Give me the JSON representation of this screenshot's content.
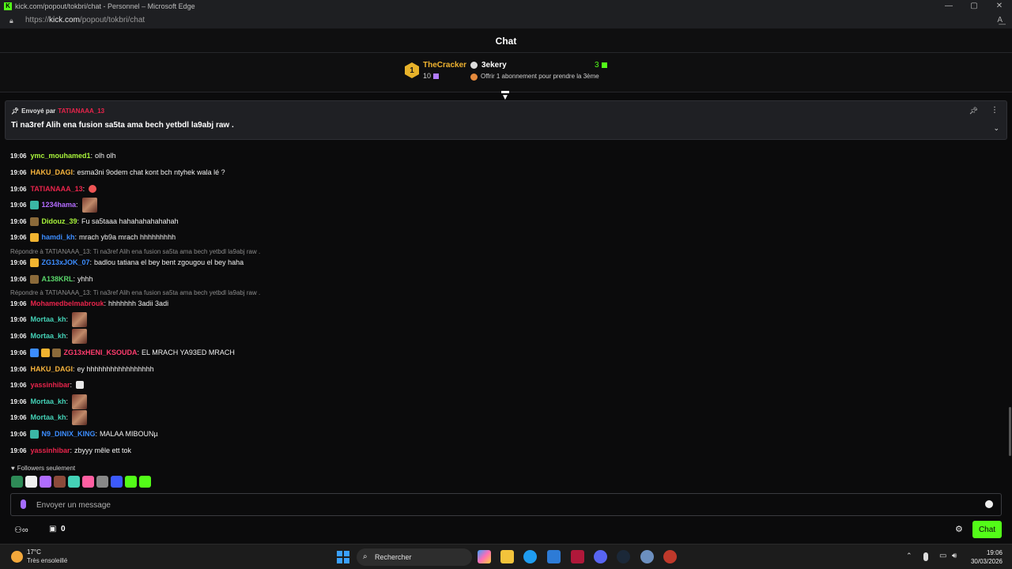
{
  "window": {
    "title": "kick.com/popout/tokbri/chat - Personnel – Microsoft Edge",
    "controls": [
      "—",
      "▢",
      "✕"
    ]
  },
  "address": {
    "scheme": "https://",
    "host": "kick.com",
    "path": "/popout/tokbri/chat"
  },
  "header": {
    "title": "Chat"
  },
  "leaderboard": {
    "rank": "1",
    "top_user": "TheCracker",
    "top_count": "10",
    "second_user": "3ekery",
    "second_count": "3",
    "offer": "Offrir 1 abonnement pour prendre la 3ème"
  },
  "pinned": {
    "sent_by_label": "Envoyé par",
    "sender": "TATIANAAA_13",
    "message": "Ti na3ref Alih ena fusion sa5ta ama bech yetbdl la9abj raw ."
  },
  "messages": [
    {
      "time": "19:06",
      "user": "ymc_mouhamed1",
      "color": "#a9f53b",
      "text": "olh olh",
      "badges": []
    },
    {
      "time": "19:06",
      "user": "HAKU_DAGI",
      "color": "#f7b43c",
      "text": "esma3ni 9odem chat kont bch ntyhek wala lé ?",
      "badges": []
    },
    {
      "time": "19:06",
      "user": "TATIANAAA_13",
      "color": "#e8244b",
      "text": "",
      "badges": [],
      "emote": "small"
    },
    {
      "time": "19:06",
      "user": "1234hama",
      "color": "#b36cff",
      "text": "",
      "badges": [
        "#3bb6a5"
      ],
      "emote": "big"
    },
    {
      "time": "19:06",
      "user": "Didouz_39",
      "color": "#a9f53b",
      "text": "Fu sa5taaa hahahahahahahah",
      "badges": [
        "#8b6a3a"
      ]
    },
    {
      "time": "19:06",
      "user": "hamdi_kh",
      "color": "#3c8dff",
      "text": "mrach yb9a mrach hhhhhhhhh",
      "badges": [
        "#f0b330"
      ]
    },
    {
      "time": "19:06",
      "user": "ZG13xJOK_07",
      "color": "#3c8dff",
      "text": "badlou tatiana el bey bent zgougou el bey haha",
      "badges": [
        "#f0b330"
      ]
    },
    {
      "time": "19:06",
      "user": "A138KRL",
      "color": "#5ad66b",
      "text": "yhhh",
      "badges": [
        "#8b6a3a"
      ]
    },
    {
      "time": "19:06",
      "user": "Mohamedbelmabrouk",
      "color": "#e8244b",
      "text": "hhhhhhh 3adii 3adi",
      "badges": []
    },
    {
      "time": "19:06",
      "user": "Mortaa_kh",
      "color": "#44d2b7",
      "text": "",
      "badges": [],
      "emote": "big"
    },
    {
      "time": "19:06",
      "user": "Mortaa_kh",
      "color": "#44d2b7",
      "text": "",
      "badges": [],
      "emote": "big"
    },
    {
      "time": "19:06",
      "user": "ZG13xHENI_KSOUDA",
      "color": "#ff3c6e",
      "text": "EL MRACH YA93ED MRACH",
      "badges": [
        "#3c8dff",
        "#f0b330",
        "#8b6a3a"
      ]
    },
    {
      "time": "19:06",
      "user": "HAKU_DAGI",
      "color": "#f7b43c",
      "text": "ey hhhhhhhhhhhhhhhhh",
      "badges": []
    },
    {
      "time": "19:06",
      "user": "yassinhibar",
      "color": "#e8244b",
      "text": "",
      "badges": [],
      "emote": "feather"
    },
    {
      "time": "19:06",
      "user": "Mortaa_kh",
      "color": "#44d2b7",
      "text": "",
      "badges": [],
      "emote": "big"
    },
    {
      "time": "19:06",
      "user": "Mortaa_kh",
      "color": "#44d2b7",
      "text": "",
      "badges": [],
      "emote": "big"
    },
    {
      "time": "19:06",
      "user": "N9_DINIX_KING",
      "color": "#3c8dff",
      "text": "MALAA MIBOUNµ",
      "badges": [
        "#3bb6a5"
      ]
    },
    {
      "time": "19:06",
      "user": "yassinhibar",
      "color": "#e8244b",
      "text": "zbyyy mêle ett tok",
      "badges": []
    }
  ],
  "replies": [
    "Répondre à TATIANAAA_13: Ti na3ref Alih ena fusion sa5ta ama bech yetbdl la9abj raw .",
    "Répondre à TATIANAAA_13: Ti na3ref Alih ena fusion sa5ta ama bech yetbdl la9abj raw ."
  ],
  "followers_only": "Followers seulement",
  "emote_colors": [
    "#2e8b57",
    "#f0f0f0",
    "#b06cff",
    "#8b4a3a",
    "#44d2b7",
    "#ff5fa2",
    "#888888",
    "#3c5aff",
    "#53fc18",
    "#53fc18"
  ],
  "input": {
    "placeholder": "Envoyer un message"
  },
  "bottom": {
    "points": "0",
    "chat_button": "Chat"
  },
  "taskbar": {
    "temp": "17°C",
    "weather": "Très ensoleillé",
    "search": "Rechercher",
    "time": "19:06",
    "date": "30/03/2026"
  }
}
